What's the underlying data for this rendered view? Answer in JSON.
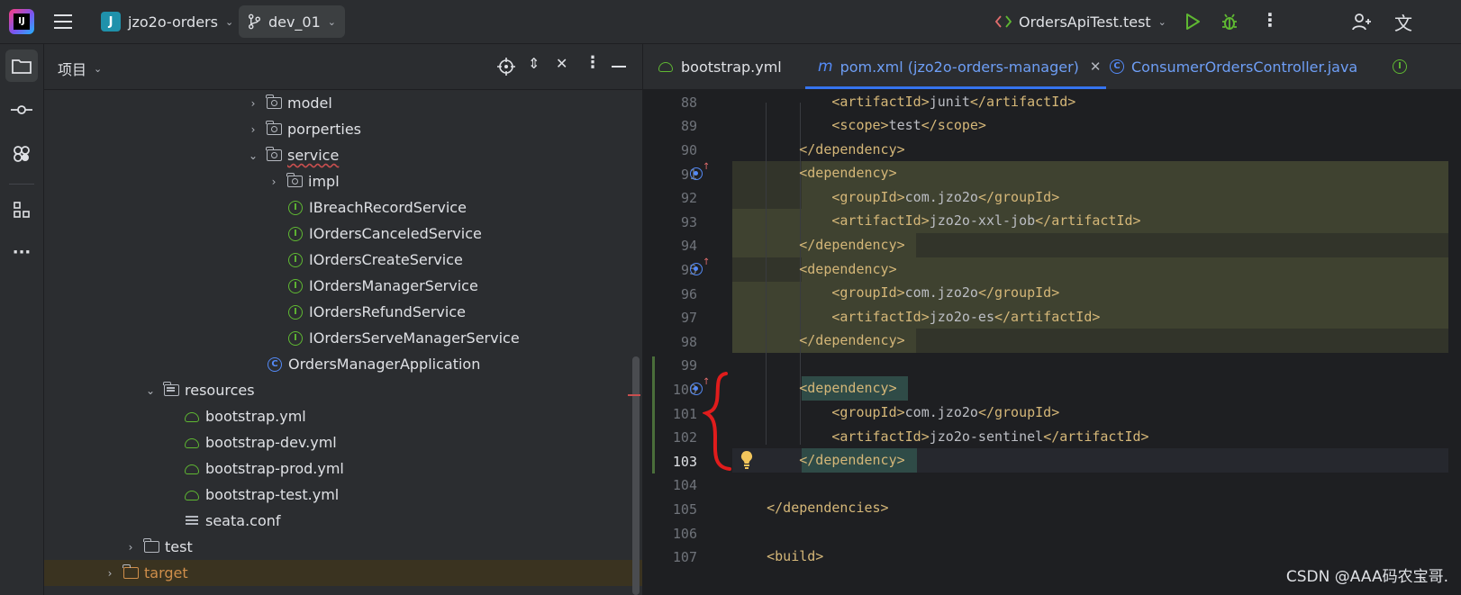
{
  "topbar": {
    "project_icon_letter": "J",
    "project_name": "jzo2o-orders",
    "branch": "dev_01",
    "run_config": "OrdersApiTest.test"
  },
  "project_panel": {
    "title": "项目",
    "tree": [
      {
        "label": "model",
        "type": "package",
        "arrow": "›"
      },
      {
        "label": "porperties",
        "type": "package",
        "arrow": "›"
      },
      {
        "label": "service",
        "type": "package",
        "arrow": "⌄"
      },
      {
        "label": "impl",
        "type": "package",
        "arrow": "›"
      },
      {
        "label": "IBreachRecordService",
        "type": "interface"
      },
      {
        "label": "IOrdersCanceledService",
        "type": "interface"
      },
      {
        "label": "IOrdersCreateService",
        "type": "interface"
      },
      {
        "label": "IOrdersManagerService",
        "type": "interface"
      },
      {
        "label": "IOrdersRefundService",
        "type": "interface"
      },
      {
        "label": "IOrdersServeManagerService",
        "type": "interface"
      },
      {
        "label": "OrdersManagerApplication",
        "type": "spring-class"
      },
      {
        "label": "resources",
        "type": "resources",
        "arrow": "⌄"
      },
      {
        "label": "bootstrap.yml",
        "type": "yml"
      },
      {
        "label": "bootstrap-dev.yml",
        "type": "yml"
      },
      {
        "label": "bootstrap-prod.yml",
        "type": "yml"
      },
      {
        "label": "bootstrap-test.yml",
        "type": "yml"
      },
      {
        "label": "seata.conf",
        "type": "text"
      },
      {
        "label": "test",
        "type": "folder",
        "arrow": "›"
      },
      {
        "label": "target",
        "type": "excluded",
        "arrow": "›"
      }
    ]
  },
  "editor": {
    "tabs": [
      {
        "label": "bootstrap.yml",
        "active": false
      },
      {
        "label": "pom.xml (jzo2o-orders-manager)",
        "active": true
      },
      {
        "label": "ConsumerOrdersController.java",
        "active": false
      }
    ],
    "lines": [
      {
        "num": "88",
        "code": "            <artifactId>junit</artifactId>"
      },
      {
        "num": "89",
        "code": "            <scope>test</scope>"
      },
      {
        "num": "90",
        "code": "        </dependency>"
      },
      {
        "num": "91",
        "code": "        <dependency>"
      },
      {
        "num": "92",
        "code": "            <groupId>com.jzo2o</groupId>"
      },
      {
        "num": "93",
        "code": "            <artifactId>jzo2o-xxl-job</artifactId>"
      },
      {
        "num": "94",
        "code": "        </dependency>"
      },
      {
        "num": "95",
        "code": "        <dependency>"
      },
      {
        "num": "96",
        "code": "            <groupId>com.jzo2o</groupId>"
      },
      {
        "num": "97",
        "code": "            <artifactId>jzo2o-es</artifactId>"
      },
      {
        "num": "98",
        "code": "        </dependency>"
      },
      {
        "num": "99",
        "code": ""
      },
      {
        "num": "100",
        "code": "        <dependency>"
      },
      {
        "num": "101",
        "code": "            <groupId>com.jzo2o</groupId>"
      },
      {
        "num": "102",
        "code": "            <artifactId>jzo2o-sentinel</artifactId>"
      },
      {
        "num": "103",
        "code": "        </dependency>"
      },
      {
        "num": "104",
        "code": ""
      },
      {
        "num": "105",
        "code": "    </dependencies>"
      },
      {
        "num": "106",
        "code": ""
      },
      {
        "num": "107",
        "code": "    <build>"
      }
    ]
  },
  "watermark": "CSDN @AAA码农宝哥."
}
